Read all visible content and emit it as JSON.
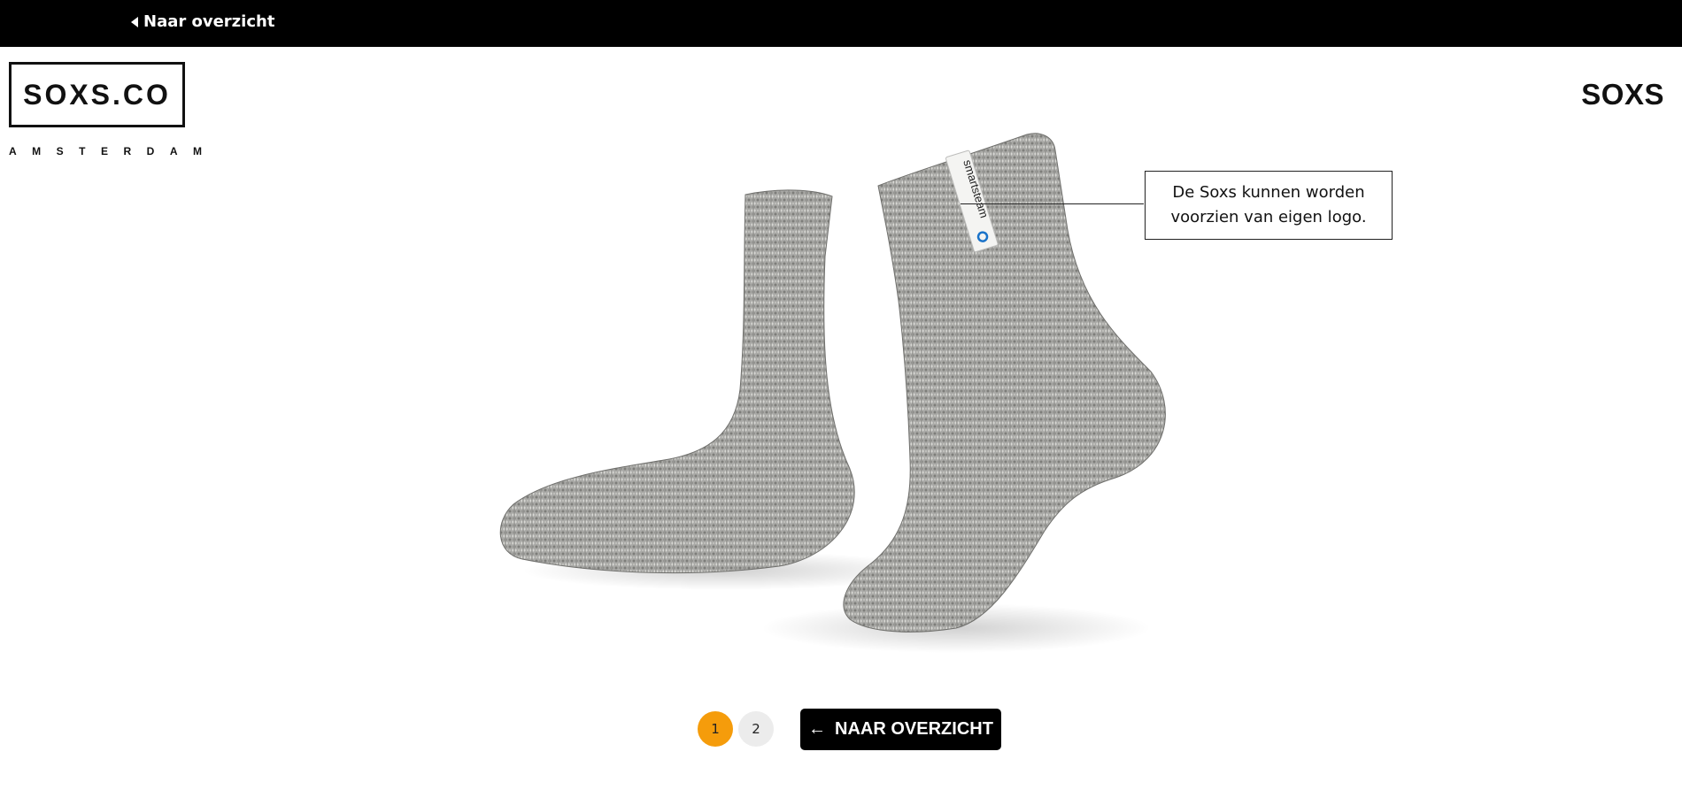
{
  "topbar": {
    "back_label": "Naar overzicht"
  },
  "logo": {
    "name": "SOXS.CO",
    "city": "AMSTERDAM"
  },
  "brand": {
    "name": "SOXS"
  },
  "product": {
    "tag_text": "smartsteam",
    "callout_text": "De Soxs kunnen worden voorzien van eigen logo."
  },
  "pager": {
    "pages": [
      "1",
      "2"
    ],
    "active": "1"
  },
  "cta": {
    "label": "NAAR OVERZICHT"
  },
  "colors": {
    "accent": "#f59c0b",
    "topbar": "#000000",
    "tag_blue": "#1a73c9"
  }
}
